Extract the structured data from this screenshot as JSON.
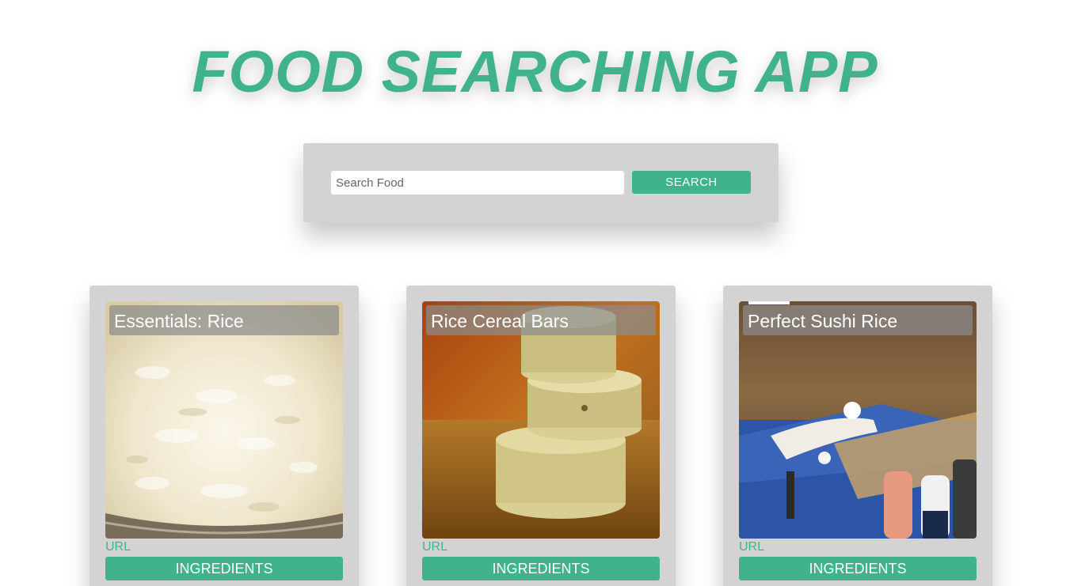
{
  "header": {
    "title": "FOOD SEARCHING APP"
  },
  "search": {
    "placeholder": "Search Food",
    "value": "",
    "button_label": "SEARCH"
  },
  "recipes": [
    {
      "title": "Essentials: Rice",
      "image_icon": "rice-bowl-photo",
      "link_label": "URL",
      "button_label": "INGREDIENTS"
    },
    {
      "title": "Rice Cereal Bars",
      "image_icon": "rice-cereal-bars-photo",
      "link_label": "URL",
      "button_label": "INGREDIENTS"
    },
    {
      "title": "Perfect Sushi Rice",
      "image_icon": "sushi-rice-photo",
      "link_label": "URL",
      "button_label": "INGREDIENTS"
    }
  ],
  "colors": {
    "accent": "#40b38c",
    "panel": "#d3d3d3",
    "background": "#ffffff"
  }
}
